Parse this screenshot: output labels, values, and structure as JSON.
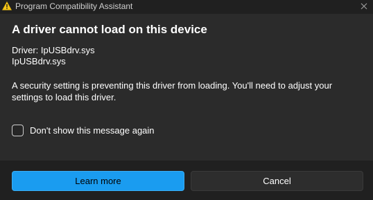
{
  "window": {
    "title": "Program Compatibility Assistant",
    "close_glyph": "✕"
  },
  "dialog": {
    "heading": "A driver cannot load on this device",
    "driver_label": "Driver: IpUSBdrv.sys",
    "driver_file": "IpUSBdrv.sys",
    "message": "A security setting is preventing this driver from loading. You'll need to adjust your settings to load this driver.",
    "checkbox_label": "Don't show this message again",
    "checkbox_checked": false
  },
  "buttons": {
    "primary_label": "Learn more",
    "secondary_label": "Cancel"
  },
  "colors": {
    "accent": "#1a9cf0",
    "warning": "#f5c518",
    "background": "#2b2b2b",
    "footer": "#202020"
  },
  "icons": {
    "title": "warning-icon",
    "close": "close-icon"
  }
}
